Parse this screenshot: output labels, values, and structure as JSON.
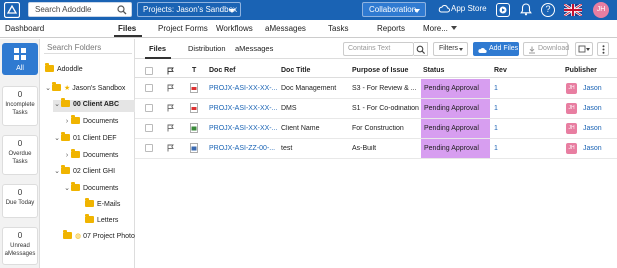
{
  "topbar": {
    "search_label": "Search Adoddle",
    "project_select": "Projects: Jason's Sandbox",
    "collaboration": "Collaboration",
    "app_store": "App Store",
    "help": "?",
    "user_initials": "JH",
    "accent": "#1a63b4"
  },
  "nav": {
    "items": [
      "Dashboard",
      "Files",
      "Project Forms",
      "Workflows",
      "aMessages",
      "Tasks",
      "Reports",
      "More..."
    ],
    "active": "Files"
  },
  "rail": {
    "all_label": "All",
    "cards": [
      {
        "count": "0",
        "label": "Incomplete Tasks"
      },
      {
        "count": "0",
        "label": "Overdue Tasks"
      },
      {
        "count": "0",
        "label": "Due Today"
      },
      {
        "count": "0",
        "label": "Unread aMessages"
      }
    ]
  },
  "folders": {
    "search_placeholder": "Search Folders",
    "tree": [
      "Adoddle",
      "Jason's Sandbox",
      "00 Client ABC",
      "Documents",
      "01 Client DEF",
      "Documents",
      "02 Client GHI",
      "Documents",
      "E-Mails",
      "Letters",
      "07 Project Photo"
    ]
  },
  "main": {
    "tabs": [
      "Files",
      "Distribution",
      "aMessages"
    ],
    "search_placeholder": "Contains Text",
    "filters_label": "Filters",
    "add_files_label": "Add Files",
    "download_label": "Download",
    "columns": [
      "T",
      "Doc Ref",
      "Doc Title",
      "Purpose of Issue",
      "Status",
      "Rev",
      "Publisher"
    ],
    "rows": [
      {
        "ref": "PROJX-ASI-XX-XX-...",
        "title": "Doc Management",
        "purpose": "S3 - For Review & ...",
        "status": "Pending Approval",
        "rev": "1",
        "pub_initials": "JH",
        "publisher": "Jason",
        "type": "pdf"
      },
      {
        "ref": "PROJX-ASI-XX-XX-...",
        "title": "DMS",
        "purpose": "S1 - For Co-odination",
        "status": "Pending Approval",
        "rev": "1",
        "pub_initials": "JH",
        "publisher": "Jason",
        "type": "pdf"
      },
      {
        "ref": "PROJX-ASI-XX-XX-...",
        "title": "Client Name",
        "purpose": "For Construction",
        "status": "Pending Approval",
        "rev": "1",
        "pub_initials": "JH",
        "publisher": "Jason",
        "type": "image"
      },
      {
        "ref": "PROJX-ASI-ZZ-00-...",
        "title": "test",
        "purpose": "As-Built",
        "status": "Pending Approval",
        "rev": "1",
        "pub_initials": "JH",
        "publisher": "Jason",
        "type": "image"
      }
    ],
    "status_color": "#d79ef0"
  }
}
